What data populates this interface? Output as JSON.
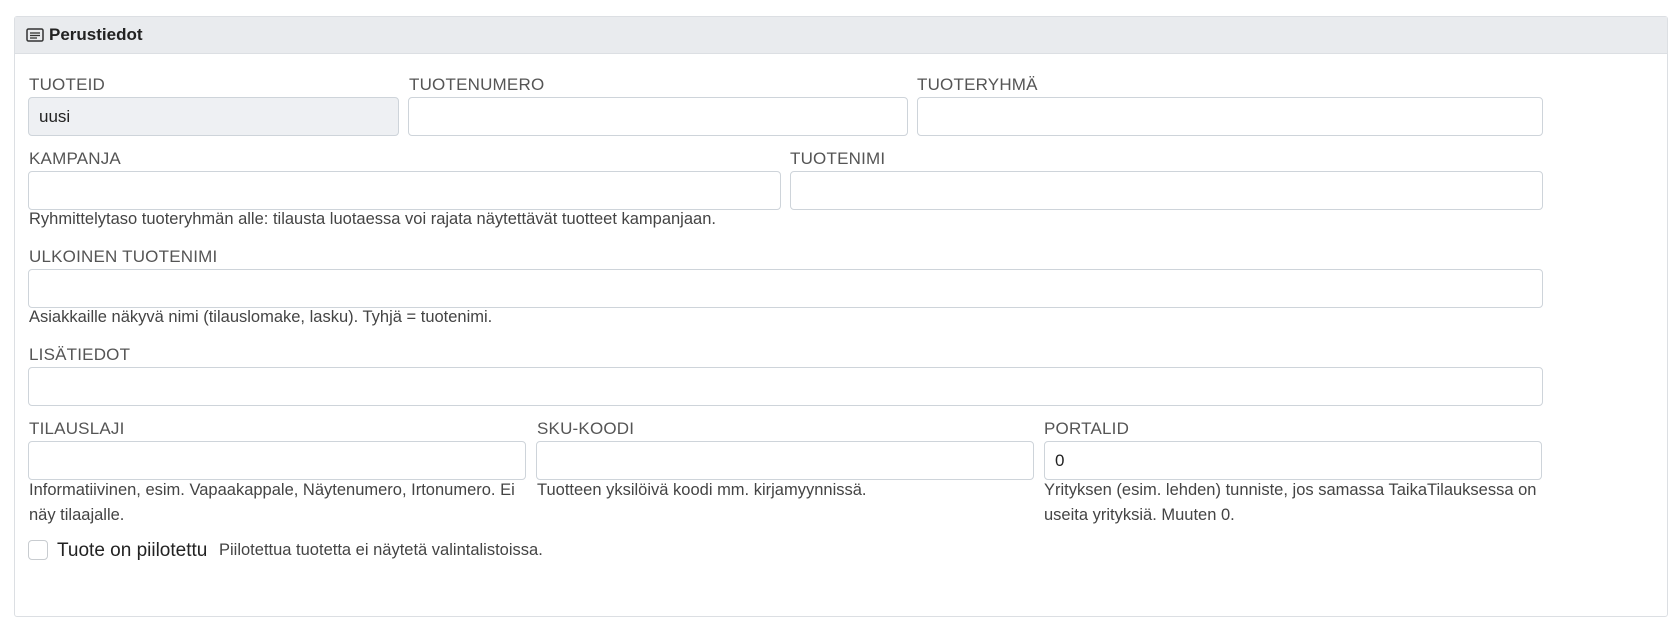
{
  "section": {
    "icon": "list-panel-icon",
    "title": "Perustiedot"
  },
  "fields": {
    "tuoteid": {
      "label": "TUOTEID",
      "value": "uusi"
    },
    "tuotenumero": {
      "label": "TUOTENUMERO",
      "value": ""
    },
    "tuoteryhma": {
      "label": "TUOTERYHMÄ",
      "value": ""
    },
    "kampanja": {
      "label": "KAMPANJA",
      "value": "",
      "help": "Ryhmittelytaso tuoteryhmän alle: tilausta luotaessa voi rajata näytettävät tuotteet kampanjaan."
    },
    "tuotenimi": {
      "label": "TUOTENIMI",
      "value": ""
    },
    "ulkoinen": {
      "label": "ULKOINEN TUOTENIMI",
      "value": "",
      "help": "Asiakkaille näkyvä nimi (tilauslomake, lasku). Tyhjä = tuotenimi."
    },
    "lisatiedot": {
      "label": "LISÄTIEDOT",
      "value": ""
    },
    "tilauslaji": {
      "label": "TILAUSLAJI",
      "value": "",
      "help": "Informatiivinen, esim. Vapaakappale, Näytenumero, Irtonumero. Ei näy tilaajalle."
    },
    "sku": {
      "label": "SKU-KOODI",
      "value": "",
      "help": "Tuotteen yksilöivä koodi mm. kirjamyynnissä."
    },
    "portalid": {
      "label": "PORTALID",
      "value": "0",
      "help": "Yrityksen (esim. lehden) tunniste, jos samassa TaikaTilauksessa on useita yrityksiä. Muuten 0."
    }
  },
  "hidden_checkbox": {
    "label": "Tuote on piilotettu",
    "help": "Piilotettua tuotetta ei näytetä valintalistoissa.",
    "checked": false
  }
}
